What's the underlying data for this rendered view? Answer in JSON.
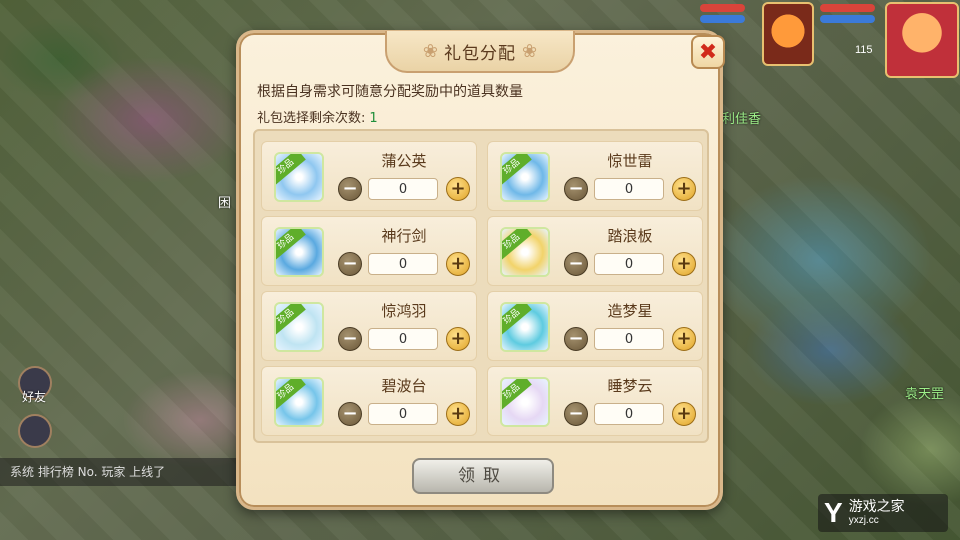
{
  "dialog": {
    "title": "礼包分配",
    "close_symbol": "✖",
    "description": "根据自身需求可随意分配奖励中的道具数量",
    "remaining_label": "礼包选择剩余次数:",
    "remaining_count": "1",
    "confirm_label": "领取",
    "items": [
      {
        "name": "蒲公英",
        "value": "0",
        "tag": "珍品",
        "color": "#8fc7f0"
      },
      {
        "name": "惊世雷",
        "value": "0",
        "tag": "珍品",
        "color": "#6fb8e8"
      },
      {
        "name": "神行剑",
        "value": "0",
        "tag": "珍品",
        "color": "#5aa9e0"
      },
      {
        "name": "踏浪板",
        "value": "0",
        "tag": "珍品",
        "color": "#f2d36a"
      },
      {
        "name": "惊鸿羽",
        "value": "0",
        "tag": "珍品",
        "color": "#bfe4f2"
      },
      {
        "name": "造梦星",
        "value": "0",
        "tag": "珍品",
        "color": "#5ecbe0"
      },
      {
        "name": "碧波台",
        "value": "0",
        "tag": "珍品",
        "color": "#76c5ea"
      },
      {
        "name": "睡梦云",
        "value": "0",
        "tag": "珍品",
        "color": "#e6d8f4"
      }
    ],
    "minus_symbol": "−",
    "plus_symbol": "+"
  },
  "hud": {
    "level": "115"
  },
  "background": {
    "friends_label": "好友",
    "npc_name_1": "利佳香",
    "npc_name_2": "袁天罡",
    "npc_name_3": "困",
    "chat_text": "系统 排行榜 No. 玩家 上线了"
  },
  "watermark": {
    "logo": "Y",
    "text": "游戏之家",
    "url": "yxzj.cc"
  }
}
